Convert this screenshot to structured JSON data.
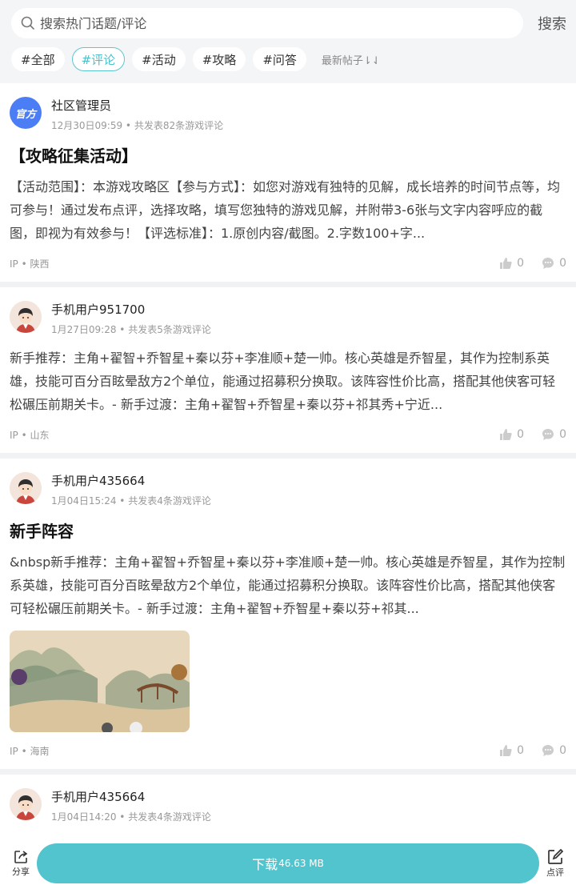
{
  "search": {
    "placeholder": "搜索热门话题/评论",
    "button": "搜索"
  },
  "tabs": [
    {
      "label": "#全部"
    },
    {
      "label": "#评论",
      "active": true
    },
    {
      "label": "#活动"
    },
    {
      "label": "#攻略"
    },
    {
      "label": "#问答"
    }
  ],
  "sort_label": "最新帖子⇂⇃",
  "posts": [
    {
      "avatar": "官方",
      "user": "社区管理员",
      "meta": "12月30日09:59 • 共发表82条游戏评论",
      "title": "【攻略征集活动】",
      "content": "【活动范围】：本游戏攻略区【参与方式】：如您对游戏有独特的见解，成长培养的时间节点等，均可参与！通过发布点评，选择攻略，填写您独特的游戏见解，并附带3-6张与文字内容呼应的截图，即视为有效参与！【评选标准】：1.原创内容/截图。2.字数100+字...",
      "ip": "IP • 陕西",
      "likes": "0",
      "comments": "0"
    },
    {
      "user": "手机用户951700",
      "meta": "1月27日09:28 • 共发表5条游戏评论",
      "content": "新手推荐：主角+翟智+乔智星+秦以芬+李准顺+楚一帅。核心英雄是乔智星，其作为控制系英雄，技能可百分百眩晕敌方2个单位，能通过招募积分换取。该阵容性价比高，搭配其他侠客可轻松碾压前期关卡。- 新手过渡：主角+翟智+乔智星+秦以芬+祁其秀+宁近...",
      "ip": "IP • 山东",
      "likes": "0",
      "comments": "0"
    },
    {
      "user": "手机用户435664",
      "meta": "1月04日15:24 • 共发表4条游戏评论",
      "title": "新手阵容",
      "content": "&nbsp新手推荐：主角+翟智+乔智星+秦以芬+李准顺+楚一帅。核心英雄是乔智星，其作为控制系英雄，技能可百分百眩晕敌方2个单位，能通过招募积分换取。该阵容性价比高，搭配其他侠客可轻松碾压前期关卡。- 新手过渡：主角+翟智+乔智星+秦以芬+祁其...",
      "ip": "IP • 海南",
      "likes": "0",
      "comments": "0"
    },
    {
      "user": "手机用户435664",
      "meta": "1月04日14:20 • 共发表4条游戏评论"
    }
  ],
  "bottom": {
    "share": "分享",
    "download": "下载",
    "size": "46.63 MB",
    "review": "点评"
  },
  "colors": {
    "accent": "#52c4cd",
    "official": "#4b7df4"
  }
}
